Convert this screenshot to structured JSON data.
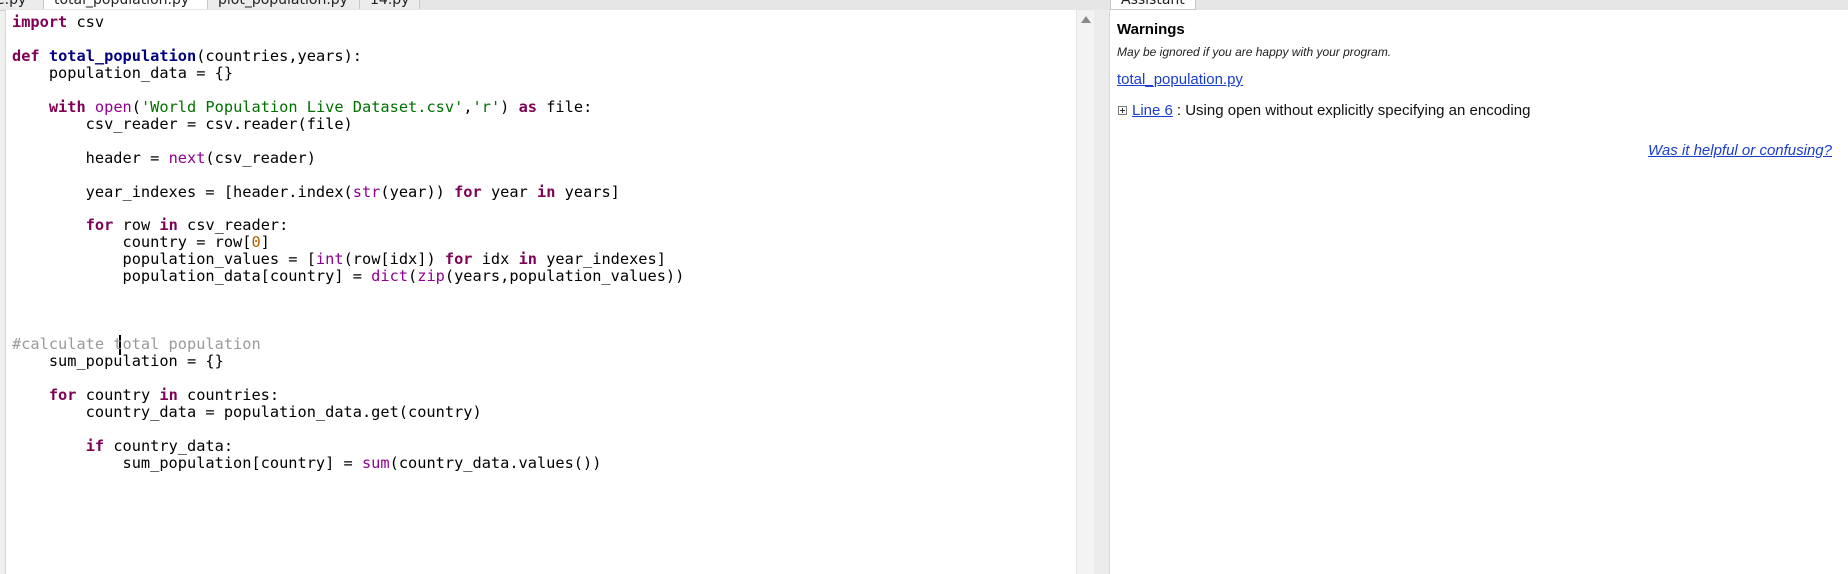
{
  "tabs": [
    {
      "label": "e.py"
    },
    {
      "label": "total_population.py"
    },
    {
      "label": "plot_population.py"
    },
    {
      "label": "14.py"
    }
  ],
  "assistant_tab": {
    "label": "Assistant"
  },
  "editor": {
    "lines": [
      {
        "tokens": [
          {
            "t": "import",
            "c": "kw"
          },
          {
            "t": " csv",
            "c": ""
          }
        ]
      },
      {
        "tokens": []
      },
      {
        "tokens": [
          {
            "t": "def",
            "c": "kw"
          },
          {
            "t": " ",
            "c": ""
          },
          {
            "t": "total_population",
            "c": "fn"
          },
          {
            "t": "(countries,years):",
            "c": ""
          }
        ]
      },
      {
        "tokens": [
          {
            "t": "    population_data = {}",
            "c": ""
          }
        ]
      },
      {
        "tokens": []
      },
      {
        "tokens": [
          {
            "t": "    ",
            "c": ""
          },
          {
            "t": "with",
            "c": "kw"
          },
          {
            "t": " ",
            "c": ""
          },
          {
            "t": "open",
            "c": "bi"
          },
          {
            "t": "(",
            "c": ""
          },
          {
            "t": "'World Population Live Dataset.csv'",
            "c": "str"
          },
          {
            "t": ",",
            "c": ""
          },
          {
            "t": "'r'",
            "c": "str"
          },
          {
            "t": ") ",
            "c": ""
          },
          {
            "t": "as",
            "c": "kw"
          },
          {
            "t": " file:",
            "c": ""
          }
        ]
      },
      {
        "tokens": [
          {
            "t": "        csv_reader = csv.reader(file)",
            "c": ""
          }
        ]
      },
      {
        "tokens": []
      },
      {
        "tokens": [
          {
            "t": "        header = ",
            "c": ""
          },
          {
            "t": "next",
            "c": "bi"
          },
          {
            "t": "(csv_reader)",
            "c": ""
          }
        ]
      },
      {
        "tokens": []
      },
      {
        "tokens": [
          {
            "t": "        year_indexes = [header.index(",
            "c": ""
          },
          {
            "t": "str",
            "c": "bi"
          },
          {
            "t": "(year)) ",
            "c": ""
          },
          {
            "t": "for",
            "c": "kw"
          },
          {
            "t": " year ",
            "c": ""
          },
          {
            "t": "in",
            "c": "kw"
          },
          {
            "t": " years]",
            "c": ""
          }
        ]
      },
      {
        "tokens": []
      },
      {
        "tokens": [
          {
            "t": "        ",
            "c": ""
          },
          {
            "t": "for",
            "c": "kw"
          },
          {
            "t": " row ",
            "c": ""
          },
          {
            "t": "in",
            "c": "kw"
          },
          {
            "t": " csv_reader:",
            "c": ""
          }
        ]
      },
      {
        "tokens": [
          {
            "t": "            country = row[",
            "c": ""
          },
          {
            "t": "0",
            "c": "num"
          },
          {
            "t": "]",
            "c": ""
          }
        ]
      },
      {
        "tokens": [
          {
            "t": "            population_values = [",
            "c": ""
          },
          {
            "t": "int",
            "c": "bi"
          },
          {
            "t": "(row[idx]) ",
            "c": ""
          },
          {
            "t": "for",
            "c": "kw"
          },
          {
            "t": " idx ",
            "c": ""
          },
          {
            "t": "in",
            "c": "kw"
          },
          {
            "t": " year_indexes]",
            "c": ""
          }
        ]
      },
      {
        "tokens": [
          {
            "t": "            population_data[country] = ",
            "c": ""
          },
          {
            "t": "dict",
            "c": "bi"
          },
          {
            "t": "(",
            "c": ""
          },
          {
            "t": "zip",
            "c": "bi"
          },
          {
            "t": "(years,population_values))",
            "c": ""
          }
        ]
      },
      {
        "tokens": []
      },
      {
        "tokens": []
      },
      {
        "tokens": []
      },
      {
        "tokens": [
          {
            "t": "#calculate total population",
            "c": "cmt"
          }
        ]
      },
      {
        "tokens": [
          {
            "t": "    sum_population = {}",
            "c": ""
          }
        ]
      },
      {
        "tokens": []
      },
      {
        "tokens": [
          {
            "t": "    ",
            "c": ""
          },
          {
            "t": "for",
            "c": "kw"
          },
          {
            "t": " country ",
            "c": ""
          },
          {
            "t": "in",
            "c": "kw"
          },
          {
            "t": " countries:",
            "c": ""
          }
        ]
      },
      {
        "tokens": [
          {
            "t": "        country_data = population_data.get(country)",
            "c": ""
          }
        ]
      },
      {
        "tokens": []
      },
      {
        "tokens": [
          {
            "t": "        ",
            "c": ""
          },
          {
            "t": "if",
            "c": "kw"
          },
          {
            "t": " country_data:",
            "c": ""
          }
        ]
      },
      {
        "tokens": [
          {
            "t": "            sum_population[country] = ",
            "c": ""
          },
          {
            "t": "sum",
            "c": "bi"
          },
          {
            "t": "(country_data.values())",
            "c": ""
          }
        ]
      }
    ]
  },
  "assistant": {
    "title": "Warnings",
    "note": "May be ignored if you are happy with your program.",
    "file_link": "total_population.py",
    "warning": {
      "line_link": "Line 6",
      "message": ": Using open without explicitly specifying an encoding"
    },
    "feedback_link": "Was it helpful or confusing?"
  }
}
